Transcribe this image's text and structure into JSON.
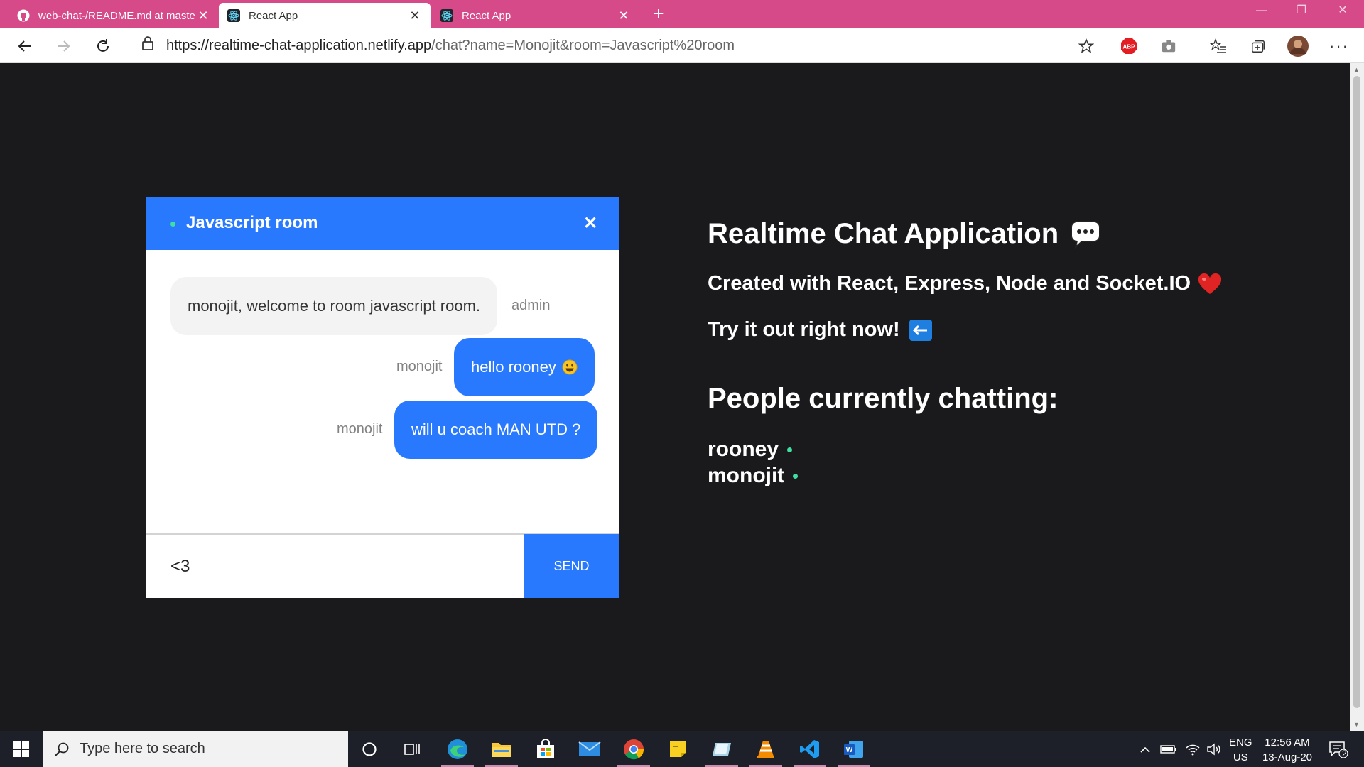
{
  "browser": {
    "tabs": [
      {
        "title": "web-chat-/README.md at maste",
        "icon": "github-icon",
        "active": false
      },
      {
        "title": "React App",
        "icon": "react-icon",
        "active": true
      },
      {
        "title": "React App",
        "icon": "react-icon",
        "active": false
      }
    ],
    "url_host": "https://realtime-chat-application.netlify.app",
    "url_path": "/chat?name=Monojit&room=Javascript%20room"
  },
  "chat": {
    "room_name": "Javascript room",
    "close_label": "✕",
    "messages": [
      {
        "text": "monojit, welcome to room javascript room.",
        "sender": "admin",
        "mine": false
      },
      {
        "text": "hello rooney",
        "emoji": "smiley",
        "sender": "monojit",
        "mine": true
      },
      {
        "text": "will u coach MAN UTD ?",
        "sender": "monojit",
        "mine": true
      }
    ],
    "input_value": "<3",
    "send_label": "SEND"
  },
  "info": {
    "title": "Realtime Chat Application",
    "subtitle": "Created with React, Express, Node and Socket.IO",
    "try_it": "Try it out right now!",
    "people_heading": "People currently chatting:",
    "people": [
      "rooney",
      "monojit"
    ]
  },
  "taskbar": {
    "search_placeholder": "Type here to search",
    "lang_top": "ENG",
    "lang_bottom": "US",
    "time": "12:56 AM",
    "date": "13-Aug-20",
    "notification_count": "2"
  },
  "colors": {
    "accent": "#2979ff",
    "online": "#3ee0a1",
    "titlebar": "#d64a8a",
    "page_bg": "#1a1a1d"
  }
}
